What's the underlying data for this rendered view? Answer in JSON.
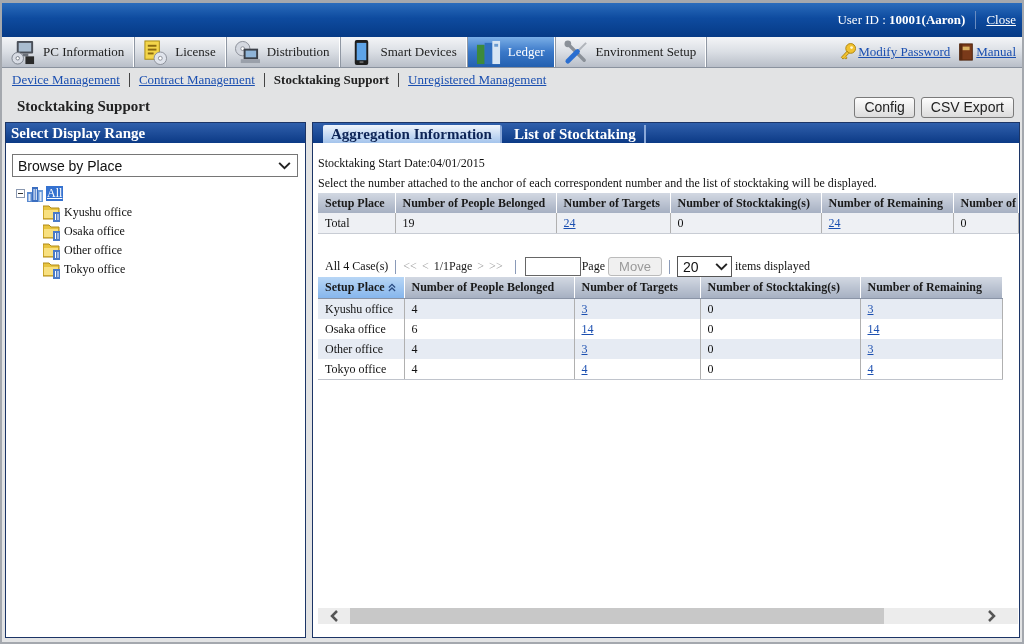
{
  "header": {
    "user": "User ID : **10001(Aaron)**",
    "close_link": "Close"
  },
  "tabs": [
    {
      "label": "PC Information",
      "selected": false
    },
    {
      "label": "License",
      "selected": false
    },
    {
      "label": "Distribution",
      "selected": false
    },
    {
      "label": "Smart Devices",
      "selected": false
    },
    {
      "label": "Ledger",
      "selected": true
    },
    {
      "label": "Environment Setup",
      "selected": false
    }
  ],
  "top_links": [
    "Modify Password",
    "Manual"
  ],
  "subnav": [
    {
      "label": "Device Management",
      "selected": false
    },
    {
      "label": "Contract Management",
      "selected": false
    },
    {
      "label": "Stocktaking Support",
      "selected": true
    },
    {
      "label": "Unregistered Management",
      "selected": false
    }
  ],
  "page_title": "Stocktaking Support",
  "buttons": [
    "Config",
    "CSV Export"
  ],
  "left_panel": {
    "title": "Select Display Range",
    "dropdown": {
      "value": "Browse by Place"
    },
    "tree": [
      {
        "label": "All",
        "expanded": true,
        "selected": true,
        "children": [
          {
            "label": "Kyushu office",
            "selected": false
          },
          {
            "label": "Osaka office",
            "selected": false
          },
          {
            "label": "Other office",
            "selected": false
          },
          {
            "label": "Tokyo office",
            "selected": false
          }
        ]
      }
    ]
  },
  "right_panel": {
    "tabs": [
      {
        "label": "Aggregation Information",
        "selected": true
      },
      {
        "label": "List of Stocktaking",
        "selected": false
      }
    ],
    "start_date": "Stocktaking Start Date:04/01/2015",
    "instruction": "Select the number attached to the anchor of each correspondent number and the list of stocktaking will be displayed.",
    "summary_table": {
      "columns": [
        {
          "label": "Setup Place",
          "links": false
        },
        {
          "label": "Number of People Belonged",
          "links": false
        },
        {
          "label": "Number of Targets",
          "links": true
        },
        {
          "label": "Number of Stocktaking(s)",
          "links": false
        },
        {
          "label": "Number of Remaining",
          "links": true
        },
        {
          "label": "Number of",
          "links": false
        }
      ],
      "rows": [
        [
          "Total",
          "19",
          "24",
          "0",
          "24",
          "0"
        ]
      ]
    },
    "pager": {
      "count": "All 4 Case(s)",
      "controls": [
        {
          "kind": "nav",
          "label": "<<",
          "disabled": true
        },
        {
          "kind": "nav",
          "label": "<",
          "disabled": true
        },
        {
          "kind": "info",
          "label": "1/1Page"
        },
        {
          "kind": "nav",
          "label": ">",
          "disabled": true
        },
        {
          "kind": "nav",
          "label": ">>",
          "disabled": true
        }
      ],
      "page_input": {
        "label": "Page"
      },
      "move_button": {
        "label": "Move",
        "disabled": true
      },
      "per_page": {
        "value": "20",
        "label": "items displayed"
      }
    },
    "detail_table": {
      "columns": [
        {
          "label": "Setup Place",
          "sorted": true,
          "links": false
        },
        {
          "label": "Number of People Belonged",
          "sorted": false,
          "links": false
        },
        {
          "label": "Number of Targets",
          "sorted": false,
          "links": true
        },
        {
          "label": "Number of Stocktaking(s)",
          "sorted": false,
          "links": false
        },
        {
          "label": "Number of Remaining",
          "sorted": false,
          "links": true
        }
      ],
      "rows": [
        [
          "Kyushu office",
          "4",
          "3",
          "0",
          "3"
        ],
        [
          "Osaka office",
          "6",
          "14",
          "0",
          "14"
        ],
        [
          "Other office",
          "4",
          "3",
          "0",
          "3"
        ],
        [
          "Tokyo office",
          "4",
          "4",
          "0",
          "4"
        ]
      ]
    }
  }
}
